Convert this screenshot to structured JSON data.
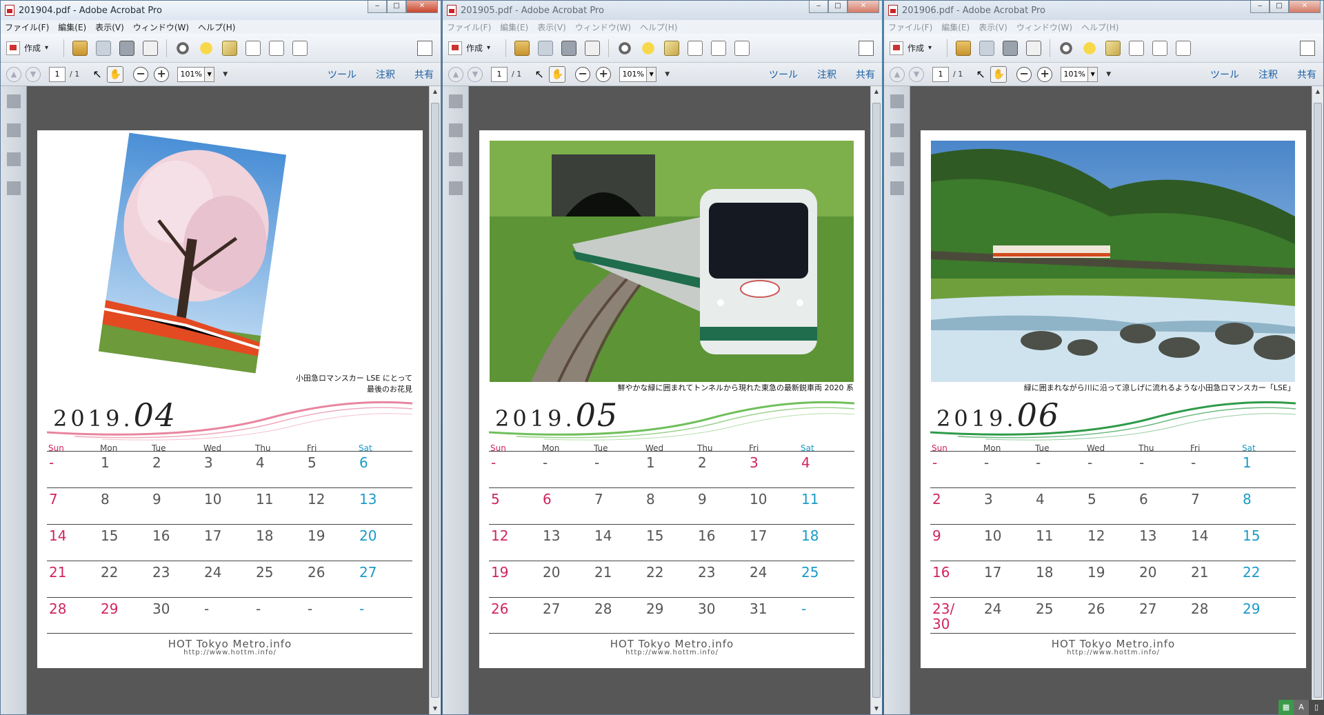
{
  "menu": [
    "ファイル(F)",
    "編集(E)",
    "表示(V)",
    "ウィンドウ(W)",
    "ヘルプ(H)"
  ],
  "toolbar": {
    "create": "作成",
    "page_current": "1",
    "page_total": "/ 1",
    "zoom": "101%",
    "tools": "ツール",
    "comment": "注釈",
    "share": "共有"
  },
  "window_buttons": {
    "minimize": "‒",
    "maximize": "□",
    "close": "✕"
  },
  "days": [
    "Sun",
    "Mon",
    "Tue",
    "Wed",
    "Thu",
    "Fri",
    "Sat"
  ],
  "footer": {
    "site": "HOT Tokyo Metro.info",
    "url": "http://www.hottm.info/"
  },
  "windows": [
    {
      "title": "201904.pdf - Adobe Acrobat Pro",
      "year": "2019.",
      "month": "04",
      "caption": [
        "小田急ロマンスカー LSE にとって",
        "最後のお花見"
      ],
      "swoosh_color": "#e8859f",
      "rows": [
        [
          "-",
          "1",
          "2",
          "3",
          "4",
          "5",
          "6"
        ],
        [
          "7",
          "8",
          "9",
          "10",
          "11",
          "12",
          "13"
        ],
        [
          "14",
          "15",
          "16",
          "17",
          "18",
          "19",
          "20"
        ],
        [
          "21",
          "22",
          "23",
          "24",
          "25",
          "26",
          "27"
        ],
        [
          "28",
          "29",
          "30",
          "-",
          "-",
          "-",
          "-"
        ]
      ],
      "holidays": [
        "29"
      ]
    },
    {
      "title": "201905.pdf - Adobe Acrobat Pro",
      "year": "2019.",
      "month": "05",
      "caption": [
        "鮮やかな緑に囲まれてトンネルから現れた東急の最新鋭車両 2020 系"
      ],
      "swoosh_color": "#6fbf5a",
      "rows": [
        [
          "-",
          "-",
          "-",
          "1",
          "2",
          "3",
          "4"
        ],
        [
          "5",
          "6",
          "7",
          "8",
          "9",
          "10",
          "11"
        ],
        [
          "12",
          "13",
          "14",
          "15",
          "16",
          "17",
          "18"
        ],
        [
          "19",
          "20",
          "21",
          "22",
          "23",
          "24",
          "25"
        ],
        [
          "26",
          "27",
          "28",
          "29",
          "30",
          "31",
          "-"
        ]
      ],
      "holidays": [
        "3",
        "4",
        "6"
      ]
    },
    {
      "title": "201906.pdf - Adobe Acrobat Pro",
      "year": "2019.",
      "month": "06",
      "caption": [
        "緑に囲まれながら川に沿って涼しげに流れるような小田急ロマンスカー「LSE」"
      ],
      "swoosh_color": "#2f9a48",
      "rows": [
        [
          "-",
          "-",
          "-",
          "-",
          "-",
          "-",
          "1"
        ],
        [
          "2",
          "3",
          "4",
          "5",
          "6",
          "7",
          "8"
        ],
        [
          "9",
          "10",
          "11",
          "12",
          "13",
          "14",
          "15"
        ],
        [
          "16",
          "17",
          "18",
          "19",
          "20",
          "21",
          "22"
        ],
        [
          "23/\n30",
          "24",
          "25",
          "26",
          "27",
          "28",
          "29"
        ]
      ],
      "holidays": []
    }
  ],
  "tray": [
    "▦",
    "A",
    "▯"
  ]
}
